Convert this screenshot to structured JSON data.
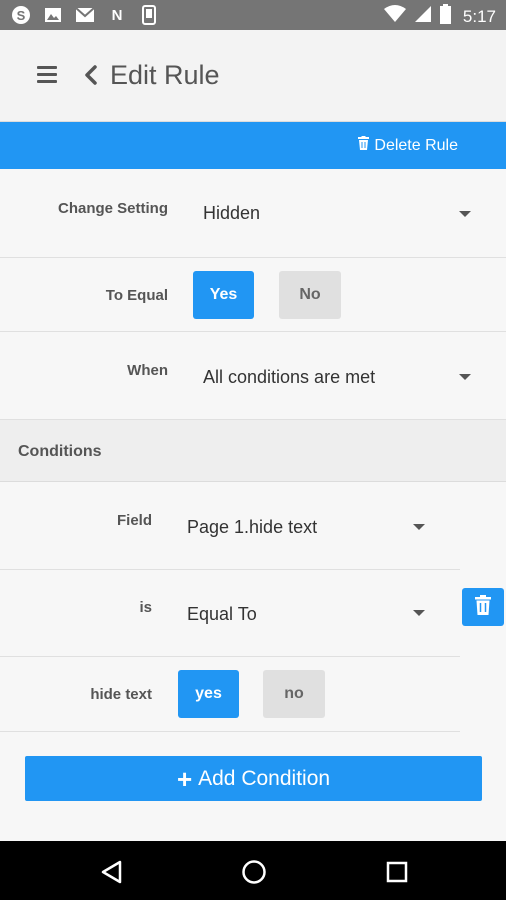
{
  "status_bar": {
    "time": "5:17",
    "left_icons": [
      "skype-icon",
      "image-icon",
      "gmail-icon",
      "n-app-icon",
      "phone-device-icon"
    ],
    "right_icons": [
      "wifi-icon",
      "signal-icon",
      "battery-icon"
    ],
    "n_icon_letter": "N"
  },
  "app_bar": {
    "title": "Edit Rule"
  },
  "action_bar": {
    "delete_label": "Delete Rule"
  },
  "rule": {
    "change_setting_label": "Change Setting",
    "change_setting_value": "Hidden",
    "to_equal_label": "To Equal",
    "yes_label": "Yes",
    "no_label": "No",
    "when_label": "When",
    "when_value": "All conditions are met"
  },
  "conditions": {
    "header": "Conditions",
    "field_label": "Field",
    "field_value": "Page 1.hide text",
    "is_label": "is",
    "is_value": "Equal To",
    "value_label": "hide text",
    "yes_label": "yes",
    "no_label": "no"
  },
  "add_condition": {
    "label": "Add Condition"
  },
  "colors": {
    "accent": "#2196f3",
    "status_bar": "#757575",
    "nav_bar": "#000000"
  }
}
